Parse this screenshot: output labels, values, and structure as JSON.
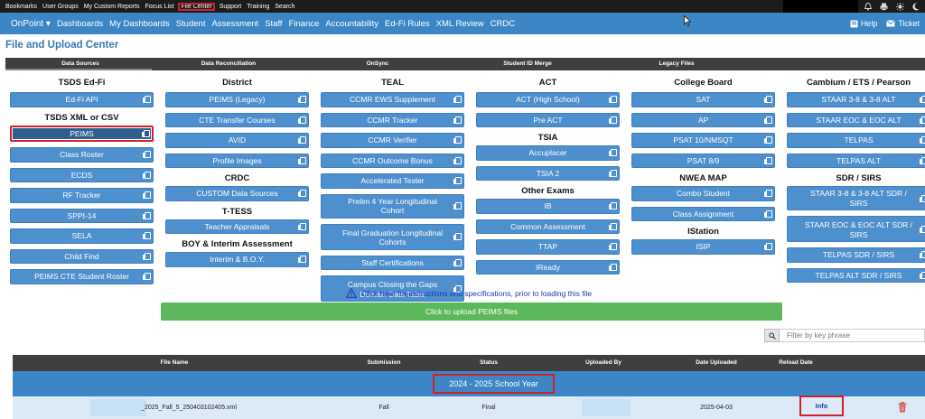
{
  "topbar": {
    "links": [
      "Bookmarks",
      "User Groups",
      "My Custom Reports",
      "Focus List",
      "File Center",
      "Support",
      "Training",
      "Search"
    ],
    "highlighted_index": 4,
    "icons": [
      "bell-icon",
      "printer-icon",
      "sun-icon",
      "moon-icon"
    ]
  },
  "nav": {
    "items": [
      "OnPoint ▾",
      "Dashboards",
      "My Dashboards",
      "Student",
      "Assessment",
      "Staff",
      "Finance",
      "Accountability",
      "Ed-Fi Rules",
      "XML Review",
      "CRDC"
    ],
    "help": "Help",
    "ticket": "Ticket"
  },
  "page": {
    "title": "File and Upload Center"
  },
  "tabs": [
    "Data Sources",
    "Data Reconciliation",
    "OnSync",
    "Student ID Merge",
    "Legacy Files"
  ],
  "columns": [
    {
      "items": [
        {
          "t": "h",
          "label": "TSDS Ed-Fi"
        },
        {
          "t": "b",
          "label": "Ed-Fi API"
        },
        {
          "t": "s",
          "label": "TSDS XML or CSV"
        },
        {
          "t": "b",
          "label": "PEIMS",
          "selected": true
        },
        {
          "t": "b",
          "label": "Class Roster"
        },
        {
          "t": "b",
          "label": "ECDS"
        },
        {
          "t": "b",
          "label": "RF Tracker"
        },
        {
          "t": "b",
          "label": "SPPI-14"
        },
        {
          "t": "b",
          "label": "SELA"
        },
        {
          "t": "b",
          "label": "Child Find"
        },
        {
          "t": "b",
          "label": "PEIMS CTE Student Roster"
        }
      ]
    },
    {
      "items": [
        {
          "t": "h",
          "label": "District"
        },
        {
          "t": "b",
          "label": "PEIMS (Legacy)"
        },
        {
          "t": "b",
          "label": "CTE Transfer Courses"
        },
        {
          "t": "b",
          "label": "AVID"
        },
        {
          "t": "b",
          "label": "Profile Images"
        },
        {
          "t": "s",
          "label": "CRDC"
        },
        {
          "t": "b",
          "label": "CUSTOM Data Sources"
        },
        {
          "t": "s",
          "label": "T-TESS"
        },
        {
          "t": "b",
          "label": "Teacher Appraisals"
        },
        {
          "t": "s",
          "label": "BOY & Interim Assessment"
        },
        {
          "t": "b",
          "label": "Interim & B.O.Y."
        }
      ]
    },
    {
      "items": [
        {
          "t": "h",
          "label": "TEAL"
        },
        {
          "t": "b",
          "label": "CCMR EWS Supplement"
        },
        {
          "t": "b",
          "label": "CCMR Tracker"
        },
        {
          "t": "b",
          "label": "CCMR Verifier"
        },
        {
          "t": "b",
          "label": "CCMR Outcome Bonus"
        },
        {
          "t": "b",
          "label": "Accelerated Tester"
        },
        {
          "t": "b",
          "label": "Prelim 4 Year Longitudinal Cohort"
        },
        {
          "t": "b",
          "label": "Final Graduation Longitudinal Cohorts",
          "tall": true
        },
        {
          "t": "b",
          "label": "Staff Certifications"
        },
        {
          "t": "b",
          "label": "Campus Closing the Gaps Domain Data Table",
          "tall": true
        }
      ]
    },
    {
      "items": [
        {
          "t": "h",
          "label": "ACT"
        },
        {
          "t": "b",
          "label": "ACT (High School)"
        },
        {
          "t": "b",
          "label": "Pre ACT"
        },
        {
          "t": "s",
          "label": "TSIA"
        },
        {
          "t": "b",
          "label": "Accuplacer"
        },
        {
          "t": "b",
          "label": "TSIA 2"
        },
        {
          "t": "s",
          "label": "Other Exams"
        },
        {
          "t": "b",
          "label": "IB"
        },
        {
          "t": "b",
          "label": "Common Assessment"
        },
        {
          "t": "b",
          "label": "TTAP"
        },
        {
          "t": "b",
          "label": "IReady"
        }
      ]
    },
    {
      "items": [
        {
          "t": "h",
          "label": "College Board"
        },
        {
          "t": "b",
          "label": "SAT"
        },
        {
          "t": "b",
          "label": "AP"
        },
        {
          "t": "b",
          "label": "PSAT 10/NMSQT"
        },
        {
          "t": "b",
          "label": "PSAT 8/9"
        },
        {
          "t": "s",
          "label": "NWEA MAP"
        },
        {
          "t": "b",
          "label": "Combo Student"
        },
        {
          "t": "b",
          "label": "Class Assignment"
        },
        {
          "t": "s",
          "label": "IStation"
        },
        {
          "t": "b",
          "label": "ISIP"
        }
      ]
    },
    {
      "items": [
        {
          "t": "h",
          "label": "Cambium / ETS / Pearson"
        },
        {
          "t": "b",
          "label": "STAAR 3-8 & 3-8 ALT"
        },
        {
          "t": "b",
          "label": "STAAR EOC & EOC ALT"
        },
        {
          "t": "b",
          "label": "TELPAS"
        },
        {
          "t": "b",
          "label": "TELPAS ALT"
        },
        {
          "t": "s",
          "label": "SDR / SIRS"
        },
        {
          "t": "b",
          "label": "STAAR 3-8 & 3-8 ALT SDR / SIRS"
        },
        {
          "t": "b",
          "label": "STAAR EOC & EOC ALT SDR / SIRS",
          "tall": true
        },
        {
          "t": "b",
          "label": "TELPAS SDR / SIRS"
        },
        {
          "t": "b",
          "label": "TELPAS ALT SDR / SIRS"
        }
      ]
    }
  ],
  "instructions": "Click here for instructions and specifications, prior to loading this file",
  "upload_button": "Click to upload PEIMS files",
  "filter": {
    "placeholder": "Filter by key phrase"
  },
  "table": {
    "headers": [
      "File Name",
      "Submission",
      "Status",
      "Uploaded By",
      "Date Uploaded",
      "Reload Date"
    ],
    "group_label": "2024 - 2025 School Year",
    "rows": [
      {
        "file_name": "_2025_Fall_5_250403102405.xml",
        "submission": "Fall",
        "status": "Final",
        "uploaded_by": "",
        "date_uploaded": "2025-04-03",
        "action": "Info"
      }
    ]
  },
  "colors": {
    "nav_blue": "#3c86c6",
    "button_blue": "#4e8fcd",
    "upload_green": "#5cb85c",
    "highlight_red": "#d0202a",
    "row_bg": "#dbeaf6"
  }
}
